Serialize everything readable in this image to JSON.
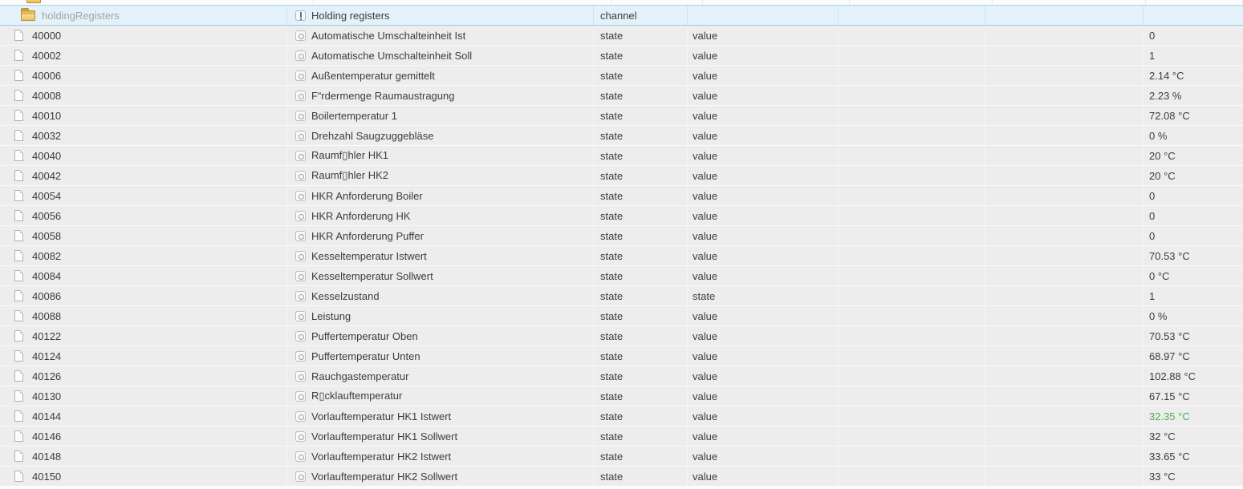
{
  "tree": {
    "parent_row": {
      "icon": "folder-icon"
    },
    "folder_row": {
      "id": "holdingRegisters",
      "name": "Holding registers",
      "type": "channel",
      "icon": "folder-icon",
      "name_icon": "channel-icon"
    }
  },
  "rows": [
    {
      "id": "40000",
      "name": "Automatische Umschalteinheit Ist",
      "type": "state",
      "role": "value",
      "value": "0"
    },
    {
      "id": "40002",
      "name": "Automatische Umschalteinheit Soll",
      "type": "state",
      "role": "value",
      "value": "1"
    },
    {
      "id": "40006",
      "name": "Außentemperatur gemittelt",
      "type": "state",
      "role": "value",
      "value": "2.14 °C"
    },
    {
      "id": "40008",
      "name": "F“rdermenge Raumaustragung",
      "type": "state",
      "role": "value",
      "value": "2.23 %"
    },
    {
      "id": "40010",
      "name": "Boilertemperatur 1",
      "type": "state",
      "role": "value",
      "value": "72.08 °C"
    },
    {
      "id": "40032",
      "name": "Drehzahl Saugzuggebläse",
      "type": "state",
      "role": "value",
      "value": "0 %"
    },
    {
      "id": "40040",
      "name": "Raumf▯hler HK1",
      "type": "state",
      "role": "value",
      "value": "20 °C"
    },
    {
      "id": "40042",
      "name": "Raumf▯hler HK2",
      "type": "state",
      "role": "value",
      "value": "20 °C"
    },
    {
      "id": "40054",
      "name": "HKR Anforderung Boiler",
      "type": "state",
      "role": "value",
      "value": "0"
    },
    {
      "id": "40056",
      "name": "HKR Anforderung HK",
      "type": "state",
      "role": "value",
      "value": "0"
    },
    {
      "id": "40058",
      "name": "HKR Anforderung Puffer",
      "type": "state",
      "role": "value",
      "value": "0"
    },
    {
      "id": "40082",
      "name": "Kesseltemperatur Istwert",
      "type": "state",
      "role": "value",
      "value": "70.53 °C"
    },
    {
      "id": "40084",
      "name": "Kesseltemperatur Sollwert",
      "type": "state",
      "role": "value",
      "value": "0 °C"
    },
    {
      "id": "40086",
      "name": "Kesselzustand",
      "type": "state",
      "role": "state",
      "value": "1"
    },
    {
      "id": "40088",
      "name": "Leistung",
      "type": "state",
      "role": "value",
      "value": "0 %"
    },
    {
      "id": "40122",
      "name": "Puffertemperatur Oben",
      "type": "state",
      "role": "value",
      "value": "70.53 °C"
    },
    {
      "id": "40124",
      "name": "Puffertemperatur Unten",
      "type": "state",
      "role": "value",
      "value": "68.97 °C"
    },
    {
      "id": "40126",
      "name": "Rauchgastemperatur",
      "type": "state",
      "role": "value",
      "value": "102.88 °C"
    },
    {
      "id": "40130",
      "name": "R▯cklauftemperatur",
      "type": "state",
      "role": "value",
      "value": "67.15 °C"
    },
    {
      "id": "40144",
      "name": "Vorlauftemperatur HK1 Istwert",
      "type": "state",
      "role": "value",
      "value": "32.35 °C",
      "value_highlight": true
    },
    {
      "id": "40146",
      "name": "Vorlauftemperatur HK1 Sollwert",
      "type": "state",
      "role": "value",
      "value": "32 °C"
    },
    {
      "id": "40148",
      "name": "Vorlauftemperatur HK2 Istwert",
      "type": "state",
      "role": "value",
      "value": "33.65 °C"
    },
    {
      "id": "40150",
      "name": "Vorlauftemperatur HK2 Sollwert",
      "type": "state",
      "role": "value",
      "value": "33 °C"
    }
  ],
  "colors": {
    "selected_bg": "#e3f2fa",
    "selected_border_top": "#b3d2dd",
    "selected_border_bottom": "#9ccadb",
    "row_bg": "#ededed",
    "value_highlight": "#4caf50",
    "text": "#3c3c3c",
    "muted_text": "#a3a3a3"
  }
}
